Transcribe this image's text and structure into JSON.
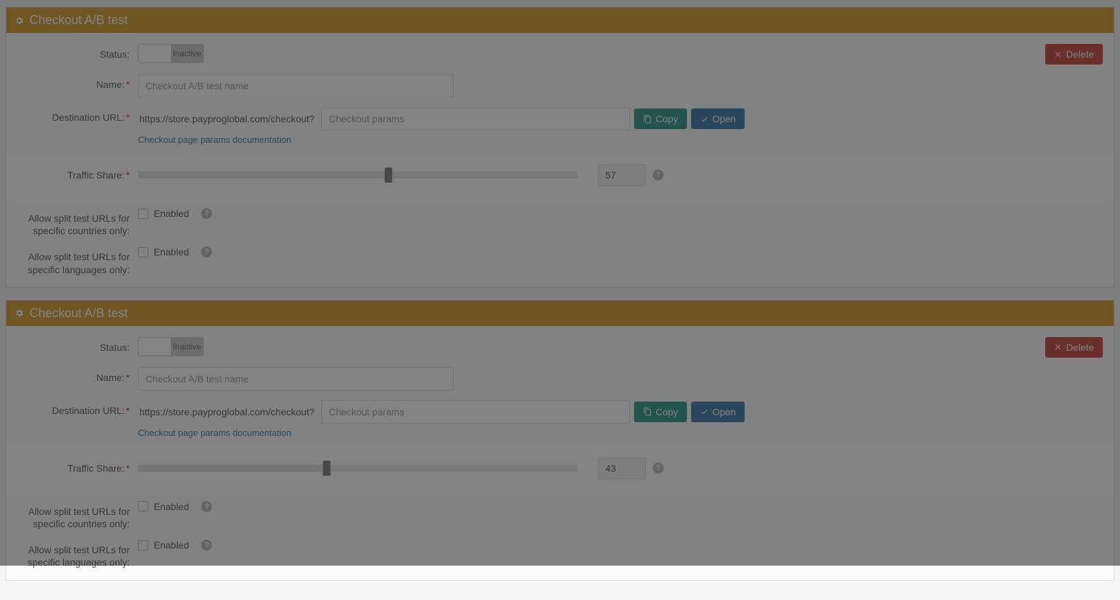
{
  "panels": [
    {
      "title": "Checkout A/B test",
      "delete_label": "Delete",
      "labels": {
        "status": "Status:",
        "name": "Name:",
        "destination_url": "Destination URL:",
        "traffic_share": "Traffic Share:",
        "countries": "Allow split test URLs for specific countries only:",
        "languages": "Allow split test URLs for specific languages only:"
      },
      "status": {
        "inactive_label": "Inactive"
      },
      "name_placeholder": "Checkout A/B test name",
      "url_prefix": "https://store.payproglobal.com/checkout?",
      "url_placeholder": "Checkout params",
      "copy_label": "Copy",
      "open_label": "Open",
      "doc_link": "Checkout page params documentation",
      "traffic_value": "57",
      "traffic_percent": 57,
      "enabled_label": "Enabled"
    },
    {
      "title": "Checkout A/B test",
      "delete_label": "Delete",
      "labels": {
        "status": "Status:",
        "name": "Name:",
        "destination_url": "Destination URL:",
        "traffic_share": "Traffic Share:",
        "countries": "Allow split test URLs for specific countries only:",
        "languages": "Allow split test URLs for specific languages only:"
      },
      "status": {
        "inactive_label": "Inactive"
      },
      "name_placeholder": "Checkout A/B test name",
      "url_prefix": "https://store.payproglobal.com/checkout?",
      "url_placeholder": "Checkout params",
      "copy_label": "Copy",
      "open_label": "Open",
      "doc_link": "Checkout page params documentation",
      "traffic_value": "43",
      "traffic_percent": 43,
      "enabled_label": "Enabled"
    }
  ]
}
